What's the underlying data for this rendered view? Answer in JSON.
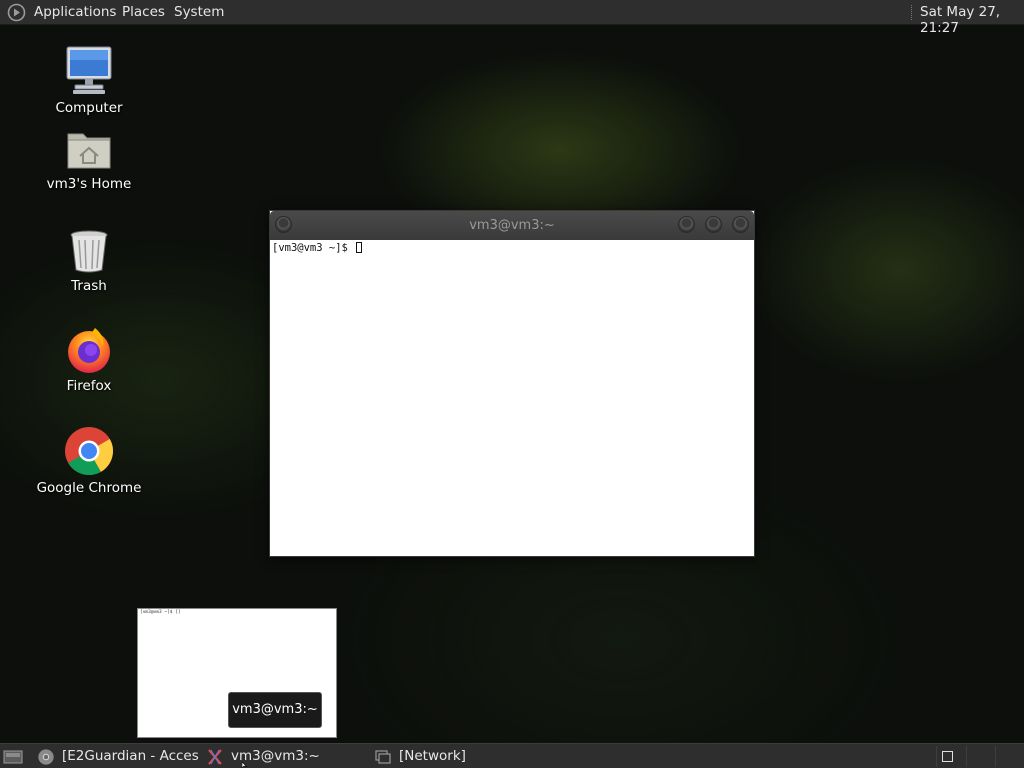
{
  "top_panel": {
    "menus": [
      "Applications",
      "Places",
      "System"
    ],
    "clock": "Sat May 27, 21:27"
  },
  "desktop_icons": [
    {
      "label": "Computer",
      "icon": "computer-icon"
    },
    {
      "label": "vm3's Home",
      "icon": "home-folder-icon"
    },
    {
      "label": "Trash",
      "icon": "trash-icon"
    },
    {
      "label": "Firefox",
      "icon": "firefox-icon"
    },
    {
      "label": "Google Chrome",
      "icon": "chrome-icon"
    }
  ],
  "terminal": {
    "title": "vm3@vm3:~",
    "prompt": "[vm3@vm3 ~]$ "
  },
  "preview": {
    "text": "[vm3@vm3 ~]$ []",
    "tooltip": "vm3@vm3:~"
  },
  "taskbar": {
    "tasks": [
      {
        "label": "[E2Guardian - Acces...",
        "icon": "chrome-icon"
      },
      {
        "label": "vm3@vm3:~",
        "icon": "terminal-x-icon"
      },
      {
        "label": "[Network]",
        "icon": "network-window-icon"
      }
    ]
  },
  "colors": {
    "panel": "#2e2e2e",
    "desktop": "#0c0f0b",
    "terminal_bg": "#ffffff"
  }
}
